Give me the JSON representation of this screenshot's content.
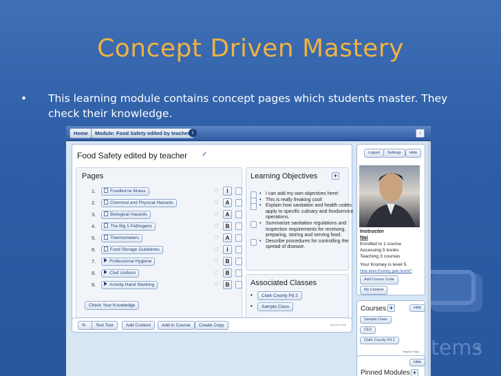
{
  "slide": {
    "title": "Concept Driven Mastery",
    "bullet_symbol": "•",
    "bullet": "This learning module contains concept pages which students master. They check their knowledge."
  },
  "watermark": {
    "text": "tems",
    "reg": "®"
  },
  "app": {
    "nav": {
      "home": "Home",
      "module": "Module: Food Safety edited by teacher",
      "info": "i",
      "arrow": "›"
    },
    "module_title": "Food Safety edited by teacher",
    "edit_mark": "✓",
    "pages": {
      "title": "Pages",
      "items": [
        {
          "num": "1.",
          "label": "Foodborne Illness",
          "kind": "page",
          "grade": "I"
        },
        {
          "num": "2.",
          "label": "Chemical and Physical Hazards",
          "kind": "page",
          "grade": "A"
        },
        {
          "num": "3.",
          "label": "Biological Hazards",
          "kind": "page",
          "grade": "A"
        },
        {
          "num": "4.",
          "label": "The Big 5 Pathogens",
          "kind": "page",
          "grade": "B"
        },
        {
          "num": "5.",
          "label": "Thermometers",
          "kind": "page",
          "grade": "A"
        },
        {
          "num": "6.",
          "label": "Food Storage Guidelines",
          "kind": "page",
          "grade": "I"
        },
        {
          "num": "7.",
          "label": "Professional Hygiene",
          "kind": "video",
          "grade": "B"
        },
        {
          "num": "8.",
          "label": "Chef Uniform",
          "kind": "video",
          "grade": "B"
        },
        {
          "num": "9.",
          "label": "Activity-Hand Washing",
          "kind": "video",
          "grade": "B"
        }
      ],
      "check_button": "Check Your Knowledge"
    },
    "objectives": {
      "title": "Learning Objectives",
      "items": [
        "I can add my own objectives here!",
        "This is really freaking cool!",
        "Explain how sanitation and health codes apply to specific culinary and foodservice operations.",
        "Summarize sanitation regulations and inspection requirements for receiving, preparing, storing and serving food.",
        "Describe procedures for controlling the spread of disease."
      ]
    },
    "classes": {
      "title": "Associated Classes",
      "items": [
        "Clark County Pd 2",
        "Sample Class"
      ]
    },
    "toolbar": {
      "test_tool": "Test Tool",
      "add_content": "Add Content",
      "add_to_course": "Add to Course",
      "create_copy": "Create Copy",
      "teacher_note": "Teacher Note"
    },
    "profile": {
      "logout": "Logout",
      "settings": "Settings",
      "hide": "Hide",
      "role": "Instructor",
      "name": "Nai",
      "line1": "Enrolled in 1 course",
      "line2": "Accessing 5 books",
      "line3": "Teaching 3 courses",
      "level": "Your Kromey is level 5.",
      "link": "How does Kromey gain levels?",
      "add_code": "Add Course Code",
      "my_content": "My Content"
    },
    "courses": {
      "title": "Courses",
      "hide": "Hide",
      "items": [
        "Sample Class",
        "CEV",
        "Clark County Pd 2"
      ],
      "footer": "Teacher Only"
    },
    "pinned": {
      "title": "Pinned Modules",
      "hide": "Hide"
    }
  }
}
